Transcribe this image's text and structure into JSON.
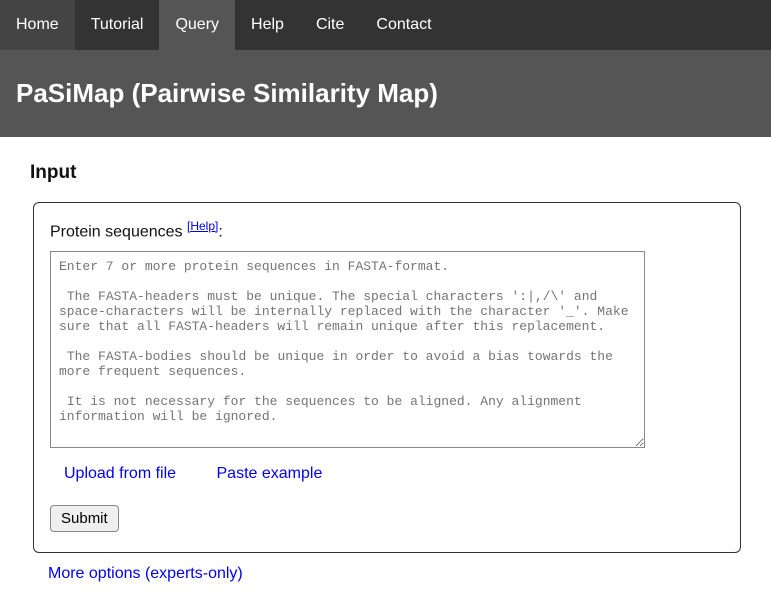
{
  "nav": {
    "items": [
      {
        "label": "Home",
        "active": false
      },
      {
        "label": "Tutorial",
        "active": false
      },
      {
        "label": "Query",
        "active": true
      },
      {
        "label": "Help",
        "active": false
      },
      {
        "label": "Cite",
        "active": false
      },
      {
        "label": "Contact",
        "active": false
      }
    ]
  },
  "title": "PaSiMap (Pairwise Similarity Map)",
  "input": {
    "heading": "Input",
    "seq_label_prefix": "Protein sequences ",
    "seq_help": "[Help]",
    "seq_label_suffix": ":",
    "placeholder": "Enter 7 or more protein sequences in FASTA-format.\n\n The FASTA-headers must be unique. The special characters ':|,/\\' and space-characters will be internally replaced with the character '_'. Make sure that all FASTA-headers will remain unique after this replacement.\n\n The FASTA-bodies should be unique in order to avoid a bias towards the more frequent sequences.\n\n It is not necessary for the sequences to be aligned. Any alignment information will be ignored.",
    "upload_label": "Upload from file",
    "paste_example_label": "Paste example",
    "submit_label": "Submit",
    "more_options_label": "More options (experts-only)"
  }
}
